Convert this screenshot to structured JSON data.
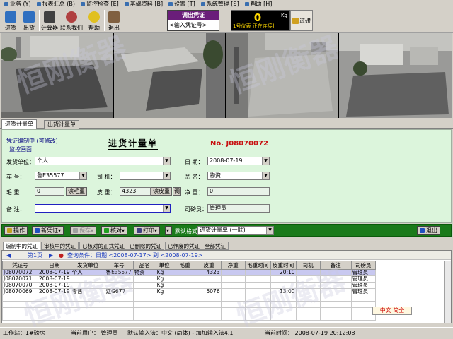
{
  "menubar": [
    {
      "label": "业务 (Y)"
    },
    {
      "label": "报表汇总 (B)"
    },
    {
      "label": "监控检查 [E]"
    },
    {
      "label": "基础资料 [B]"
    },
    {
      "label": "设置 [T]"
    },
    {
      "label": "系统管理 [S]"
    },
    {
      "label": "帮助 [H]"
    }
  ],
  "toolbar": {
    "in_label": "进货",
    "out_label": "出货",
    "calc_label": "计算器",
    "contact_label": "联系我们",
    "help_label": "帮助",
    "exit_label": "退出"
  },
  "voucher": {
    "button": "调出凭证",
    "placeholder": "<输入凭证号>"
  },
  "scale": {
    "value": "0",
    "unit": "Kg",
    "status": "1号仪表  正在连接]"
  },
  "overload_label": "过磅",
  "tabs": [
    {
      "label": "进货计量单"
    },
    {
      "label": "出货计量单"
    }
  ],
  "form": {
    "status": "凭证编制中 (可修改)",
    "monitor": "监控画面",
    "title": "进货计量单",
    "number": "No. J08070072",
    "supplier_label": "发货单位：",
    "supplier_value": "个人",
    "date_label": "日    期：",
    "date_value": "2008-07-19",
    "plate_label": "车    号：",
    "plate_value": "鲁E35577",
    "driver_label": "司    机：",
    "driver_value": "",
    "product_label": "品    名：",
    "product_value": "物资",
    "gross_label": "毛    重：",
    "gross_value": "0",
    "read_gross": "读毛重",
    "tare_label": "皮    重：",
    "tare_value": "4323",
    "read_tare": "读皮重",
    "adjust": "调",
    "net_label": "净    重：",
    "net_value": "0",
    "remark_label": "备    注：",
    "remark_value": "",
    "operator_label": "司磅员：",
    "operator_value": "管理员"
  },
  "actions": {
    "operate": "操作",
    "new": "新凭证",
    "save": "保存",
    "verify": "核对",
    "print": "打印",
    "format_label": "默认格式：",
    "format_value": "进货计量单 (一联)",
    "exit": "退出"
  },
  "subtabs": [
    {
      "label": "编制中的凭证"
    },
    {
      "label": "审核中的凭证"
    },
    {
      "label": "已核对的正式凭证"
    },
    {
      "label": "已删除的凭证"
    },
    {
      "label": "已作废的凭证"
    },
    {
      "label": "全部凭证"
    }
  ],
  "pager": {
    "page": "第1页",
    "query": "查询条件：日期 <2008-07-17> 到 <2008-07-19>"
  },
  "grid": {
    "columns": [
      "凭证号",
      "日期",
      "发货单位",
      "车号",
      "品名",
      "单位",
      "毛重",
      "皮重",
      "净重",
      "毛重时间",
      "皮重时间",
      "司机",
      "备注",
      "司磅员"
    ],
    "rows": [
      [
        "J08070072",
        "2008-07-19",
        "个人",
        "鲁E35577",
        "物资",
        "Kg",
        "",
        "4323",
        "",
        "",
        "20:10",
        "",
        "",
        "管理员"
      ],
      [
        "J08070071",
        "2008-07-19",
        "",
        "",
        "",
        "Kg",
        "",
        "",
        "",
        "",
        "",
        "",
        "",
        "管理员"
      ],
      [
        "J08070070",
        "2008-07-19",
        "",
        "",
        "",
        "Kg",
        "",
        "",
        "",
        "",
        "",
        "",
        "",
        "管理员"
      ],
      [
        "J08070069",
        "2008-07-19",
        "零售",
        "辽G677",
        "",
        "Kg",
        "",
        "5076",
        "",
        "",
        "13:00",
        "",
        "",
        "管理员"
      ],
      [
        "",
        "",
        "",
        "",
        "",
        "",
        "",
        "",
        "",
        "",
        "",
        "",
        "",
        ""
      ],
      [
        "",
        "",
        "",
        "",
        "",
        "",
        "",
        "",
        "",
        "",
        "",
        "",
        "",
        ""
      ],
      [
        "",
        "",
        "",
        "",
        "",
        "",
        "",
        "",
        "",
        "",
        "",
        "",
        "",
        ""
      ],
      [
        "",
        "",
        "",
        "",
        "",
        "",
        "",
        "",
        "",
        "",
        "",
        "",
        "",
        ""
      ]
    ]
  },
  "ime": "中文 简全",
  "status": {
    "station": "工作站：1#磅房",
    "user": "当前用户： 管理员",
    "ime_label": "默认输入法：中文 (简体) - 加加输入法4.1",
    "time": "当前时间： 2008-07-19 20:12:08"
  },
  "watermark": "恒刚衡器",
  "colors": {
    "form_bg": "#dcf5dc",
    "action_bar": "#1a7a1a",
    "voucher_btn": "#6a1e7a",
    "scale_digit": "#ffd800",
    "number_red": "#c81010"
  }
}
